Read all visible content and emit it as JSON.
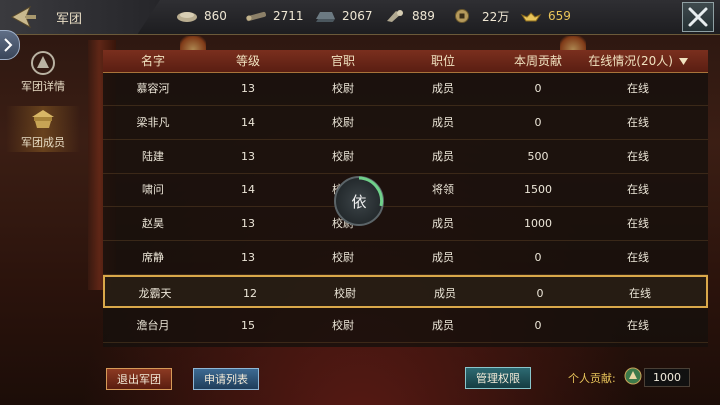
{
  "header": {
    "title": "军团",
    "resources": [
      {
        "icon": "food-icon",
        "value": "860"
      },
      {
        "icon": "wood-icon",
        "value": "2711"
      },
      {
        "icon": "iron-icon",
        "value": "2067"
      },
      {
        "icon": "silk-icon",
        "value": "889"
      },
      {
        "icon": "copper-coin-icon",
        "value": "22万"
      },
      {
        "icon": "gold-ingot-icon",
        "value": "659"
      }
    ]
  },
  "nav": {
    "tabs": [
      {
        "label": "军团详情",
        "icon": "legion-details-icon",
        "active": false
      },
      {
        "label": "军团成员",
        "icon": "legion-members-icon",
        "active": true
      }
    ]
  },
  "table": {
    "columns": [
      "名字",
      "等级",
      "官职",
      "职位",
      "本周贡献",
      "在线情况(20人)"
    ],
    "rows": [
      [
        "慕容河",
        "13",
        "校尉",
        "成员",
        "0",
        "在线"
      ],
      [
        "梁非凡",
        "14",
        "校尉",
        "成员",
        "0",
        "在线"
      ],
      [
        "陆建",
        "13",
        "校尉",
        "成员",
        "500",
        "在线"
      ],
      [
        "啸问",
        "14",
        "校尉",
        "将领",
        "1500",
        "在线"
      ],
      [
        "赵昊",
        "13",
        "校尉",
        "成员",
        "1000",
        "在线"
      ],
      [
        "席静",
        "13",
        "校尉",
        "成员",
        "0",
        "在线"
      ],
      [
        "龙霸天",
        "12",
        "校尉",
        "成员",
        "0",
        "在线"
      ],
      [
        "澹台月",
        "15",
        "校尉",
        "成员",
        "0",
        "在线"
      ]
    ],
    "selected_row": 6
  },
  "loading": {
    "glyph": "依"
  },
  "footer": {
    "exit_label": "退出军团",
    "apply_label": "申请列表",
    "manage_label": "管理权限",
    "contribution_label": "个人贡献:",
    "contribution_value": "1000"
  },
  "colors": {
    "accent_gold": "#e8c45a",
    "header_red": "#7a2f1e",
    "selection_border": "#d9a84a"
  }
}
